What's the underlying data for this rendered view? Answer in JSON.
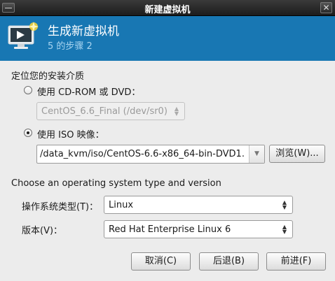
{
  "window": {
    "title": "新建虚拟机",
    "close_glyph": "✕",
    "menu_icon": "window-menu-icon",
    "close_icon": "close-icon"
  },
  "header": {
    "title": "生成新虚拟机",
    "step": "5 的步骤 2",
    "icon": "vm-monitor-icon",
    "bg_color": "#1877b3"
  },
  "media": {
    "section_label": "定位您的安装介质",
    "cdrom_option": {
      "label": "使用 CD-ROM 或 DVD：",
      "selected": false
    },
    "cdrom_device": {
      "value": "CentOS_6.6_Final (/dev/sr0)",
      "enabled": false
    },
    "iso_option": {
      "label": "使用 ISO 映像：",
      "selected": true
    },
    "iso_path": {
      "value": "/data_kvm/iso/CentOS-6.6-x86_64-bin-DVD1."
    },
    "browse_label": "浏览(W)..."
  },
  "os": {
    "section_label": "Choose an operating system type and version",
    "type_label": "操作系统类型(T)：",
    "type_value": "Linux",
    "version_label": "版本(V)：",
    "version_value": "Red Hat Enterprise Linux 6"
  },
  "buttons": {
    "cancel": "取消(C)",
    "back": "后退(B)",
    "forward": "前进(F)"
  }
}
